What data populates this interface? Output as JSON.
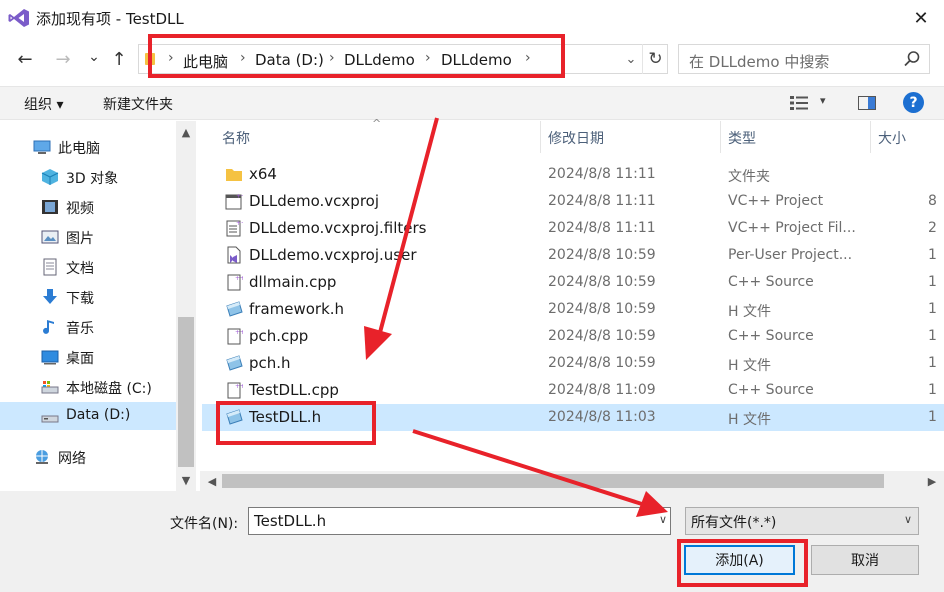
{
  "window": {
    "title": "添加现有项 - TestDLL",
    "close_glyph": "✕"
  },
  "nav": {
    "back": "←",
    "forward": "→",
    "recent": "⌄",
    "up": "↑",
    "breadcrumb": [
      "此电脑",
      "Data (D:)",
      "DLLdemo",
      "DLLdemo"
    ],
    "sep": "›",
    "refresh": "↻",
    "search_placeholder": "在 DLLdemo 中搜索"
  },
  "toolbar": {
    "organize": "组织 ▾",
    "new_folder": "新建文件夹",
    "view_drop": "▾",
    "help": "?"
  },
  "sidebar": {
    "items": [
      {
        "label": "此电脑",
        "icon": "computer-icon"
      },
      {
        "label": "3D 对象",
        "icon": "cube-icon"
      },
      {
        "label": "视频",
        "icon": "film-icon"
      },
      {
        "label": "图片",
        "icon": "picture-icon"
      },
      {
        "label": "文档",
        "icon": "document-icon"
      },
      {
        "label": "下载",
        "icon": "download-icon"
      },
      {
        "label": "音乐",
        "icon": "music-icon"
      },
      {
        "label": "桌面",
        "icon": "desktop-icon"
      },
      {
        "label": "本地磁盘 (C:)",
        "icon": "disk-icon"
      },
      {
        "label": "Data (D:)",
        "icon": "drive-icon",
        "selected": true
      },
      {
        "label": "网络",
        "icon": "network-icon"
      }
    ],
    "scroll_up": "▲",
    "scroll_down": "▼"
  },
  "columns": {
    "name": "名称",
    "date": "修改日期",
    "type": "类型",
    "size": "大小",
    "sort": "^"
  },
  "files": [
    {
      "name": "x64",
      "date": "2024/8/8 11:11",
      "type": "文件夹",
      "size": "",
      "icon": "folder-icon"
    },
    {
      "name": "DLLdemo.vcxproj",
      "date": "2024/8/8 11:11",
      "type": "VC++ Project",
      "size": "8",
      "icon": "vcxproj-icon"
    },
    {
      "name": "DLLdemo.vcxproj.filters",
      "date": "2024/8/8 11:11",
      "type": "VC++ Project Fil...",
      "size": "2",
      "icon": "filters-icon"
    },
    {
      "name": "DLLdemo.vcxproj.user",
      "date": "2024/8/8 10:59",
      "type": "Per-User Project...",
      "size": "1",
      "icon": "user-file-icon"
    },
    {
      "name": "dllmain.cpp",
      "date": "2024/8/8 10:59",
      "type": "C++ Source",
      "size": "1",
      "icon": "cpp-file-icon"
    },
    {
      "name": "framework.h",
      "date": "2024/8/8 10:59",
      "type": "H 文件",
      "size": "1",
      "icon": "header-file-icon"
    },
    {
      "name": "pch.cpp",
      "date": "2024/8/8 10:59",
      "type": "C++ Source",
      "size": "1",
      "icon": "cpp-file-icon"
    },
    {
      "name": "pch.h",
      "date": "2024/8/8 10:59",
      "type": "H 文件",
      "size": "1",
      "icon": "header-file-icon"
    },
    {
      "name": "TestDLL.cpp",
      "date": "2024/8/8 11:09",
      "type": "C++ Source",
      "size": "1",
      "icon": "cpp-file-icon"
    },
    {
      "name": "TestDLL.h",
      "date": "2024/8/8 11:03",
      "type": "H 文件",
      "size": "1",
      "icon": "header-file-icon",
      "selected": true
    }
  ],
  "hscroll": {
    "left": "◀",
    "right": "▶"
  },
  "footer": {
    "filename_label": "文件名(N):",
    "filename_value": "TestDLL.h",
    "dropdown_glyph": "∨",
    "filetype": "所有文件(*.*)",
    "add_button": "添加(A)",
    "cancel_button": "取消"
  },
  "colors": {
    "selection": "#cce8ff",
    "annotation_red": "#e8222a",
    "accent": "#0078d7"
  }
}
